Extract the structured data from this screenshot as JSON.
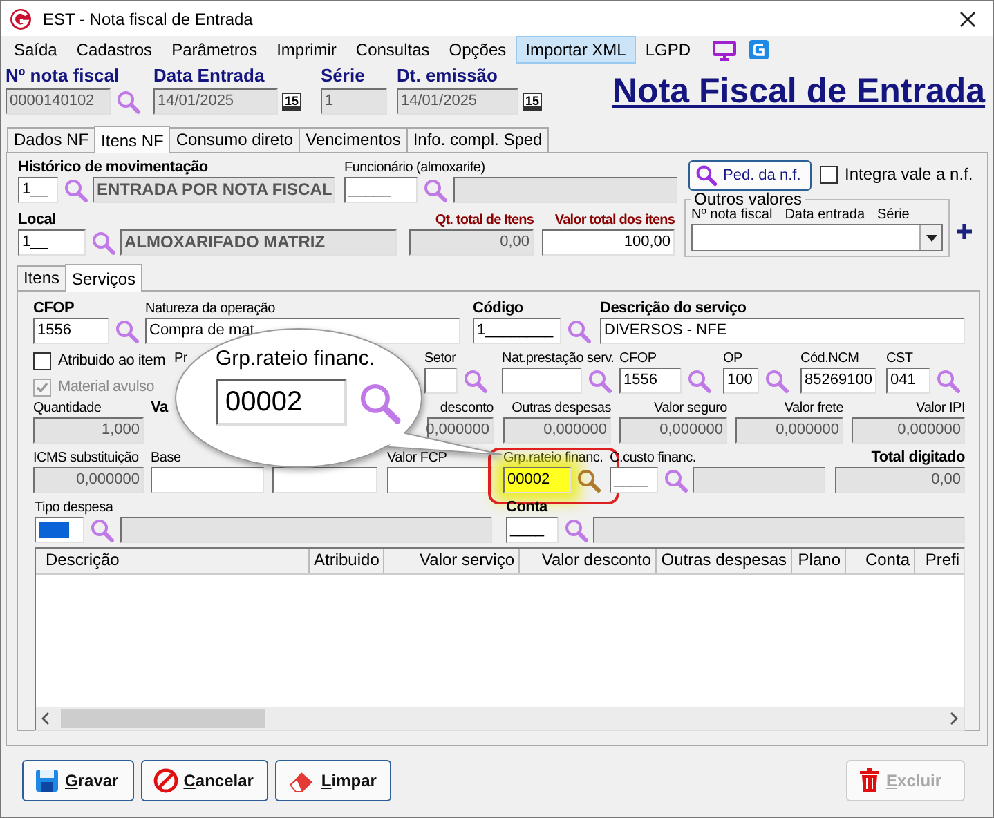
{
  "window": {
    "title": "EST - Nota fiscal de Entrada"
  },
  "menu": [
    {
      "label": "Saída",
      "selected": false
    },
    {
      "label": "Cadastros",
      "selected": false
    },
    {
      "label": "Parâmetros",
      "selected": false
    },
    {
      "label": "Imprimir",
      "selected": false
    },
    {
      "label": "Consultas",
      "selected": false
    },
    {
      "label": "Opções",
      "selected": false
    },
    {
      "label": "Importar XML",
      "selected": true
    },
    {
      "label": "LGPD",
      "selected": false
    }
  ],
  "header": {
    "fields": [
      {
        "label": "Nº nota fiscal",
        "value": "0000140102",
        "kind": "search",
        "readonly": true
      },
      {
        "label": "Data Entrada",
        "value": "14/01/2025",
        "kind": "date",
        "calendar": "15",
        "readonly": true
      },
      {
        "label": "Série",
        "value": "1",
        "kind": "plain",
        "readonly": true
      },
      {
        "label": "Dt. emissão",
        "value": "14/01/2025",
        "kind": "date",
        "calendar": "15",
        "readonly": true
      }
    ],
    "title": "Nota Fiscal de Entrada"
  },
  "tabs": [
    {
      "label": "Dados NF",
      "selected": false
    },
    {
      "label": "Itens NF",
      "selected": true
    },
    {
      "label": "Consumo direto",
      "selected": false
    },
    {
      "label": "Vencimentos",
      "selected": false
    },
    {
      "label": "Info. compl. Sped",
      "selected": false
    }
  ],
  "top_rows": [
    [
      {
        "kind": "text",
        "label": "Histórico de movimentação",
        "strong": true,
        "alert": false,
        "value": "1__",
        "readonly": false,
        "search": true
      },
      {
        "kind": "text",
        "value": "ENTRADA POR NOTA FISCAL",
        "readonly": true
      },
      {
        "kind": "text",
        "label": "Funcionário (almoxarife)",
        "strong": false,
        "alert": false,
        "value": "_____",
        "readonly": false,
        "search": true
      },
      {
        "kind": "text",
        "readonly": true
      }
    ],
    [
      {
        "kind": "text",
        "label": "Local",
        "strong": true,
        "alert": false,
        "value": "1__",
        "readonly": false,
        "search": true
      },
      {
        "kind": "text",
        "value": "ALMOXARIFADO MATRIZ",
        "readonly": true
      },
      {
        "kind": "number",
        "label": "Qt. total de Itens",
        "strong": true,
        "alert": true,
        "value": "0,00",
        "readonly": true
      },
      {
        "kind": "number",
        "label": "Valor total dos itens",
        "strong": true,
        "alert": true,
        "value": "100,00",
        "readonly": false
      }
    ]
  ],
  "side": {
    "button": "Ped. da n.f.",
    "check": {
      "label": "Integra vale a n.f.",
      "checked": false
    },
    "group": {
      "title": "Outros valores",
      "columns": [
        "Nº nota fiscal",
        "Data entrada",
        "Série"
      ]
    }
  },
  "subtabs": [
    {
      "label": "Itens",
      "selected": false
    },
    {
      "label": "Serviços",
      "selected": true
    }
  ],
  "rows": [
    [
      {
        "kind": "text",
        "label": "CFOP",
        "strong": true,
        "value": "1556",
        "readonly": false,
        "search": true
      },
      {
        "kind": "text",
        "label": "Natureza da operação",
        "strong": false,
        "value": "Compra de mat",
        "readonly": false
      },
      {
        "kind": "text",
        "label": "Código",
        "strong": true,
        "value": "1________",
        "readonly": false,
        "search": true
      },
      {
        "kind": "text",
        "label": "Descrição do serviço",
        "strong": true,
        "value": "DIVERSOS - NFE",
        "readonly": false
      }
    ],
    [
      {
        "kind": "checks",
        "items": [
          {
            "label": "Atribuido ao item",
            "checked": false,
            "disabled": false
          },
          {
            "label": "Material avulso",
            "checked": true,
            "disabled": true
          }
        ]
      },
      {
        "kind": "label",
        "label": "Pr",
        "strong": false
      },
      {
        "kind": "text",
        "label": "Setor",
        "strong": false,
        "readonly": false,
        "search": true
      },
      {
        "kind": "text",
        "label": "Nat.prestação serv.",
        "strong": false,
        "readonly": false,
        "search": true
      },
      {
        "kind": "text",
        "label": "CFOP",
        "strong": false,
        "value": "1556",
        "readonly": false,
        "search": true
      },
      {
        "kind": "text",
        "label": "OP",
        "strong": false,
        "value": "100",
        "readonly": false,
        "search": true
      },
      {
        "kind": "text",
        "label": "Cód.NCM",
        "strong": false,
        "value": "85269100",
        "readonly": false
      },
      {
        "kind": "text",
        "label": "CST",
        "strong": false,
        "value": "041",
        "readonly": false,
        "search": true
      }
    ],
    [
      {
        "kind": "number",
        "label": "Quantidade",
        "strong": false,
        "value": "1,000",
        "readonly": true
      },
      {
        "kind": "label",
        "label": "Va",
        "strong": true
      },
      {
        "kind": "number",
        "label": "desconto",
        "strong": false,
        "value": "0,000000",
        "readonly": true
      },
      {
        "kind": "number",
        "label": "Outras despesas",
        "strong": false,
        "value": "0,000000",
        "readonly": true
      },
      {
        "kind": "number",
        "label": "Valor seguro",
        "strong": false,
        "value": "0,000000",
        "readonly": true
      },
      {
        "kind": "number",
        "label": "Valor frete",
        "strong": false,
        "value": "0,000000",
        "readonly": true
      },
      {
        "kind": "number",
        "label": "Valor IPI",
        "strong": false,
        "value": "0,000000",
        "readonly": true
      }
    ],
    [
      {
        "kind": "number",
        "label": "ICMS substituição",
        "strong": false,
        "value": "0,000000",
        "readonly": true
      },
      {
        "kind": "text",
        "label": "Base",
        "strong": false,
        "readonly": false
      },
      {
        "kind": "number",
        "readonly": false
      },
      {
        "kind": "text",
        "label": "Valor FCP",
        "strong": false,
        "readonly": false
      },
      {
        "kind": "text",
        "label": "Grp.rateio financ.",
        "strong": false,
        "value": "00002",
        "readonly": false,
        "search": true,
        "highlighted": true
      },
      {
        "kind": "text",
        "label": "C.custo financ.",
        "strong": false,
        "value": "____",
        "readonly": false,
        "search": true
      },
      {
        "kind": "text",
        "readonly": true
      },
      {
        "kind": "number",
        "label": "Total digitado",
        "strong": true,
        "value": "0,00",
        "readonly": true
      }
    ],
    [
      {
        "kind": "text",
        "label": "Tipo despesa",
        "strong": false,
        "readonly": false,
        "search": true,
        "text_selected": true
      },
      {
        "kind": "text",
        "readonly": true
      },
      {
        "kind": "text",
        "label": "Conta",
        "strong": true,
        "value": "____",
        "readonly": false,
        "search": true
      },
      {
        "kind": "text",
        "readonly": true
      }
    ]
  ],
  "callout": {
    "label": "Grp.rateio financ.",
    "value": "00002"
  },
  "table": {
    "columns": [
      "Descrição",
      "Atribuido",
      "Valor serviço",
      "Valor desconto",
      "Outras despesas",
      "Plano",
      "Conta",
      "Prefi"
    ]
  },
  "buttons": [
    {
      "label": "Gravar",
      "kind": "save",
      "disabled": false
    },
    {
      "label": "Cancelar",
      "kind": "cancel",
      "disabled": false
    },
    {
      "label": "Limpar",
      "kind": "clear",
      "disabled": false
    },
    {
      "label": "Excluir",
      "kind": "delete",
      "disabled": true
    }
  ]
}
